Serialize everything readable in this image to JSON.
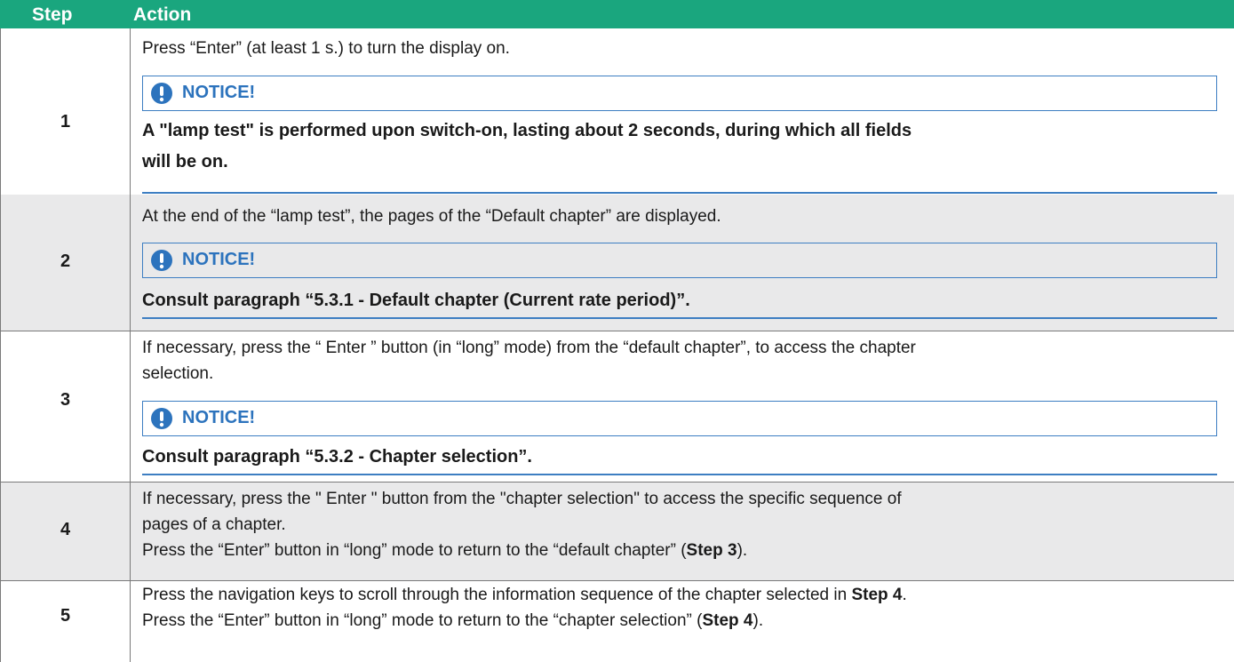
{
  "header": {
    "step": "Step",
    "action": "Action"
  },
  "notice_label": "NOTICE!",
  "rows": [
    {
      "step": "1",
      "text": "Press “Enter” (at least 1 s.) to turn the display on.",
      "notice_text_1": "A \"lamp test\" is performed upon switch-on, lasting about 2 seconds, during which all fields",
      "notice_text_2": "will be on."
    },
    {
      "step": "2",
      "text": "At the end of the “lamp test”, the pages of the “Default chapter” are displayed.",
      "notice_text_1": "Consult paragraph “5.3.1  - Default chapter (Current rate period)”."
    },
    {
      "step": "3",
      "text_1": "If necessary, press the “ Enter ” button (in “long” mode) from the “default chapter”, to access the chapter",
      "text_2": "selection.",
      "notice_text_1": "Consult paragraph “5.3.2  - Chapter selection”."
    },
    {
      "step": "4",
      "text_1": "If necessary, press the \" Enter \" button from the \"chapter selection\" to access the specific sequence of",
      "text_2": "pages of a chapter.",
      "text_3": "Press the “Enter” button in “long” mode to return to the “default chapter” (",
      "text_3_bold": "Step 3",
      "text_3_end": ")."
    },
    {
      "step": "5",
      "text_1": "Press the navigation keys to scroll through the information sequence of the chapter selected in ",
      "text_1_bold": "Step 4",
      "text_1_end": ".",
      "text_2": "Press the “Enter” button in “long” mode to return to the “chapter selection” (",
      "text_2_bold": "Step 4",
      "text_2_end": ")."
    }
  ],
  "colors": {
    "header_bg": "#1aa67e",
    "notice_blue": "#2c73bd",
    "grey_row": "#e9e9ea"
  },
  "icons": {
    "notice": "exclamation-circle-icon"
  }
}
